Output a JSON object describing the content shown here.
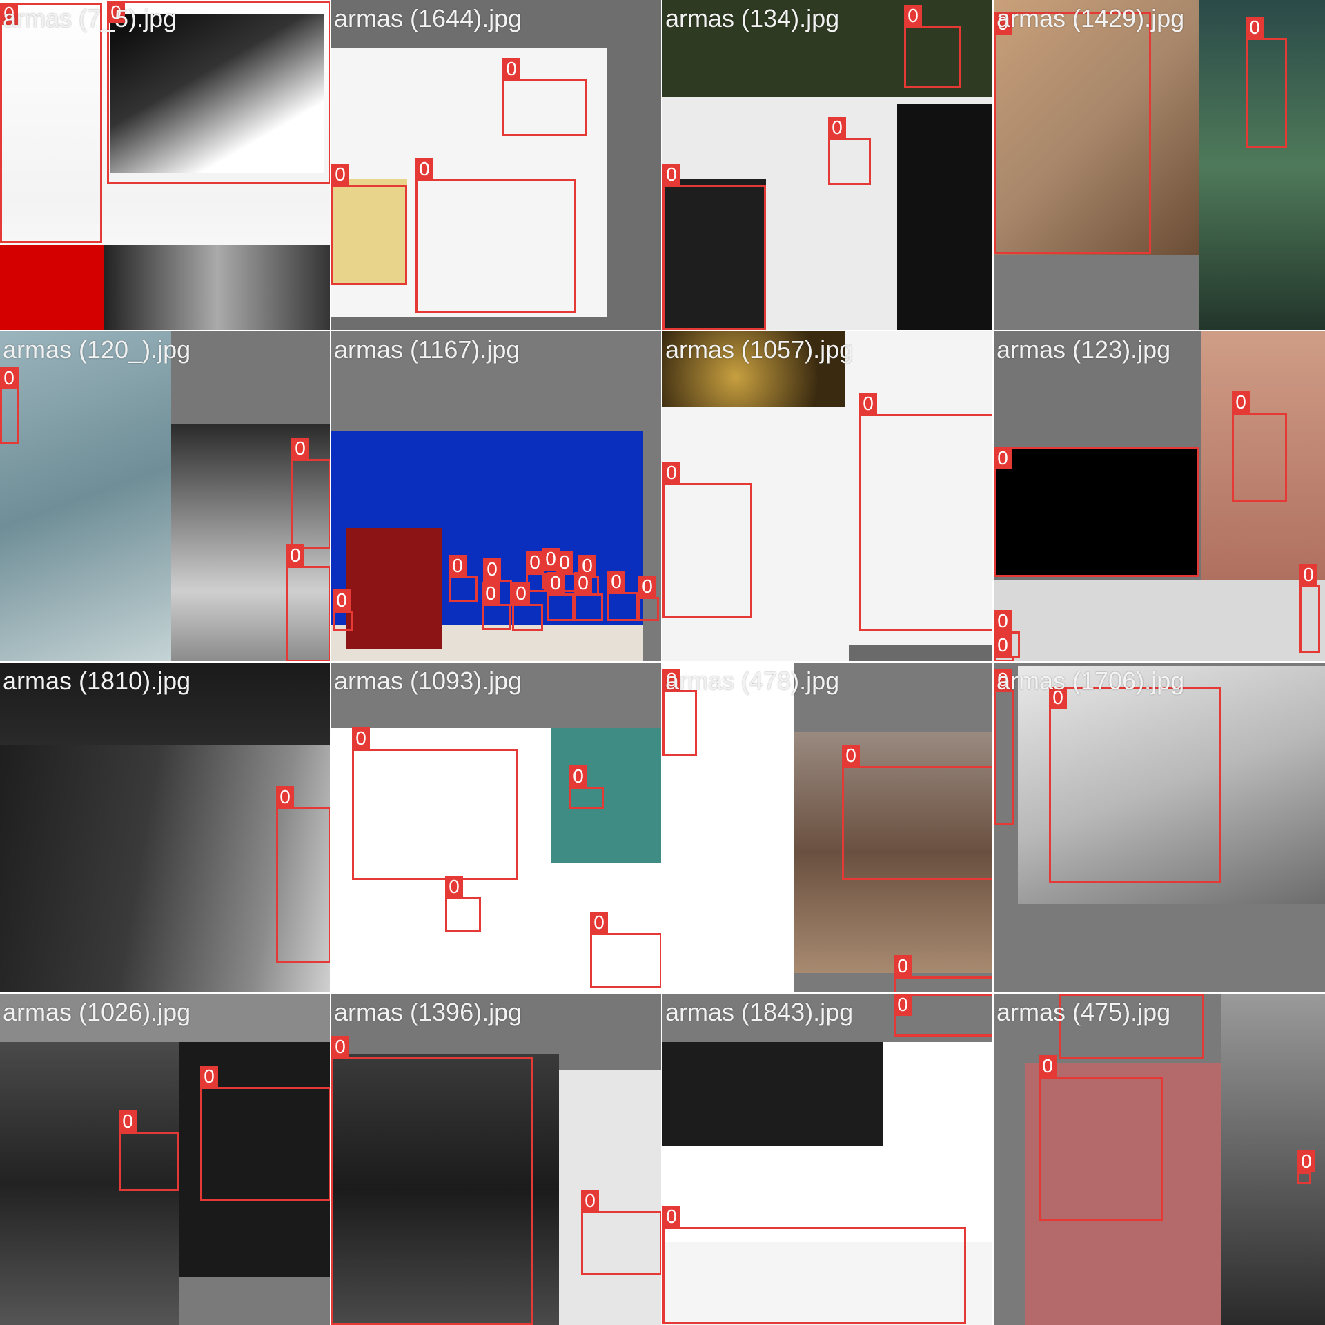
{
  "mosaic": {
    "box_color": "#e53935",
    "tiles": [
      {
        "title": "armas (7_5).jpg",
        "boxes": [
          "0",
          "0"
        ]
      },
      {
        "title": "armas (1644).jpg",
        "boxes": [
          "0",
          "0",
          "0"
        ]
      },
      {
        "title": "armas (134).jpg",
        "boxes": [
          "0",
          "0",
          "0"
        ]
      },
      {
        "title": "armas (1429).jpg",
        "boxes": [
          "0",
          "0"
        ]
      },
      {
        "title": "armas (120_).jpg",
        "boxes": [
          "0",
          "0",
          "0"
        ]
      },
      {
        "title": "armas (1167).jpg",
        "boxes": [
          "0",
          "0",
          "0",
          "0",
          "0",
          "0",
          "0",
          "0",
          "0",
          "0",
          "0",
          "0",
          "0"
        ]
      },
      {
        "title": "armas (1057).jpg",
        "boxes": [
          "0",
          "0"
        ]
      },
      {
        "title": "armas (123).jpg",
        "boxes": [
          "0",
          "0",
          "0",
          "0",
          "0"
        ]
      },
      {
        "title": "armas (1810).jpg",
        "boxes": [
          "0"
        ]
      },
      {
        "title": "armas (1093).jpg",
        "boxes": [
          "0",
          "0",
          "0",
          "0"
        ]
      },
      {
        "title": "armas (478).jpg",
        "boxes": [
          "0",
          "0",
          "0"
        ]
      },
      {
        "title": "armas (1706).jpg",
        "boxes": [
          "0",
          "0"
        ]
      },
      {
        "title": "armas (1026).jpg",
        "boxes": [
          "0",
          "0"
        ]
      },
      {
        "title": "armas (1396).jpg",
        "boxes": [
          "0",
          "0"
        ]
      },
      {
        "title": "armas (1843).jpg",
        "boxes": [
          "0",
          "0"
        ]
      },
      {
        "title": "armas (475).jpg",
        "boxes": [
          "0",
          "0",
          "0"
        ]
      }
    ]
  }
}
